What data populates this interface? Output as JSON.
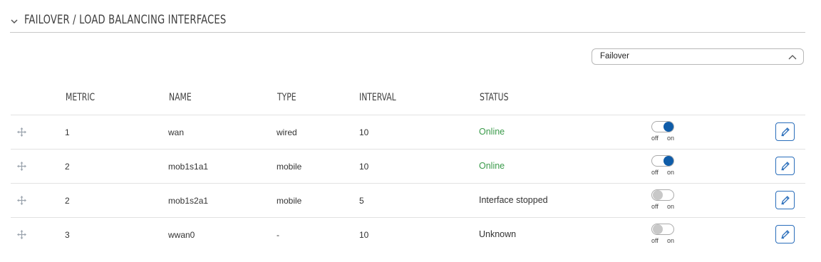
{
  "section": {
    "title": "FAILOVER / LOAD BALANCING INTERFACES"
  },
  "mode_select": {
    "value": "Failover"
  },
  "columns": {
    "metric": "METRIC",
    "name": "NAME",
    "type": "TYPE",
    "interval": "INTERVAL",
    "status": "STATUS"
  },
  "toggle_labels": {
    "off": "off",
    "on": "on"
  },
  "colors": {
    "online": "#3a9a4a",
    "accent": "#0f5ca8",
    "edit_border": "#2a6ebb"
  },
  "rows": [
    {
      "metric": "1",
      "name": "wan",
      "type": "wired",
      "interval": "10",
      "status": "Online",
      "enabled": true
    },
    {
      "metric": "2",
      "name": "mob1s1a1",
      "type": "mobile",
      "interval": "10",
      "status": "Online",
      "enabled": true
    },
    {
      "metric": "2",
      "name": "mob1s2a1",
      "type": "mobile",
      "interval": "5",
      "status": "Interface stopped",
      "enabled": false
    },
    {
      "metric": "3",
      "name": "wwan0",
      "type": "-",
      "interval": "10",
      "status": "Unknown",
      "enabled": false
    }
  ]
}
